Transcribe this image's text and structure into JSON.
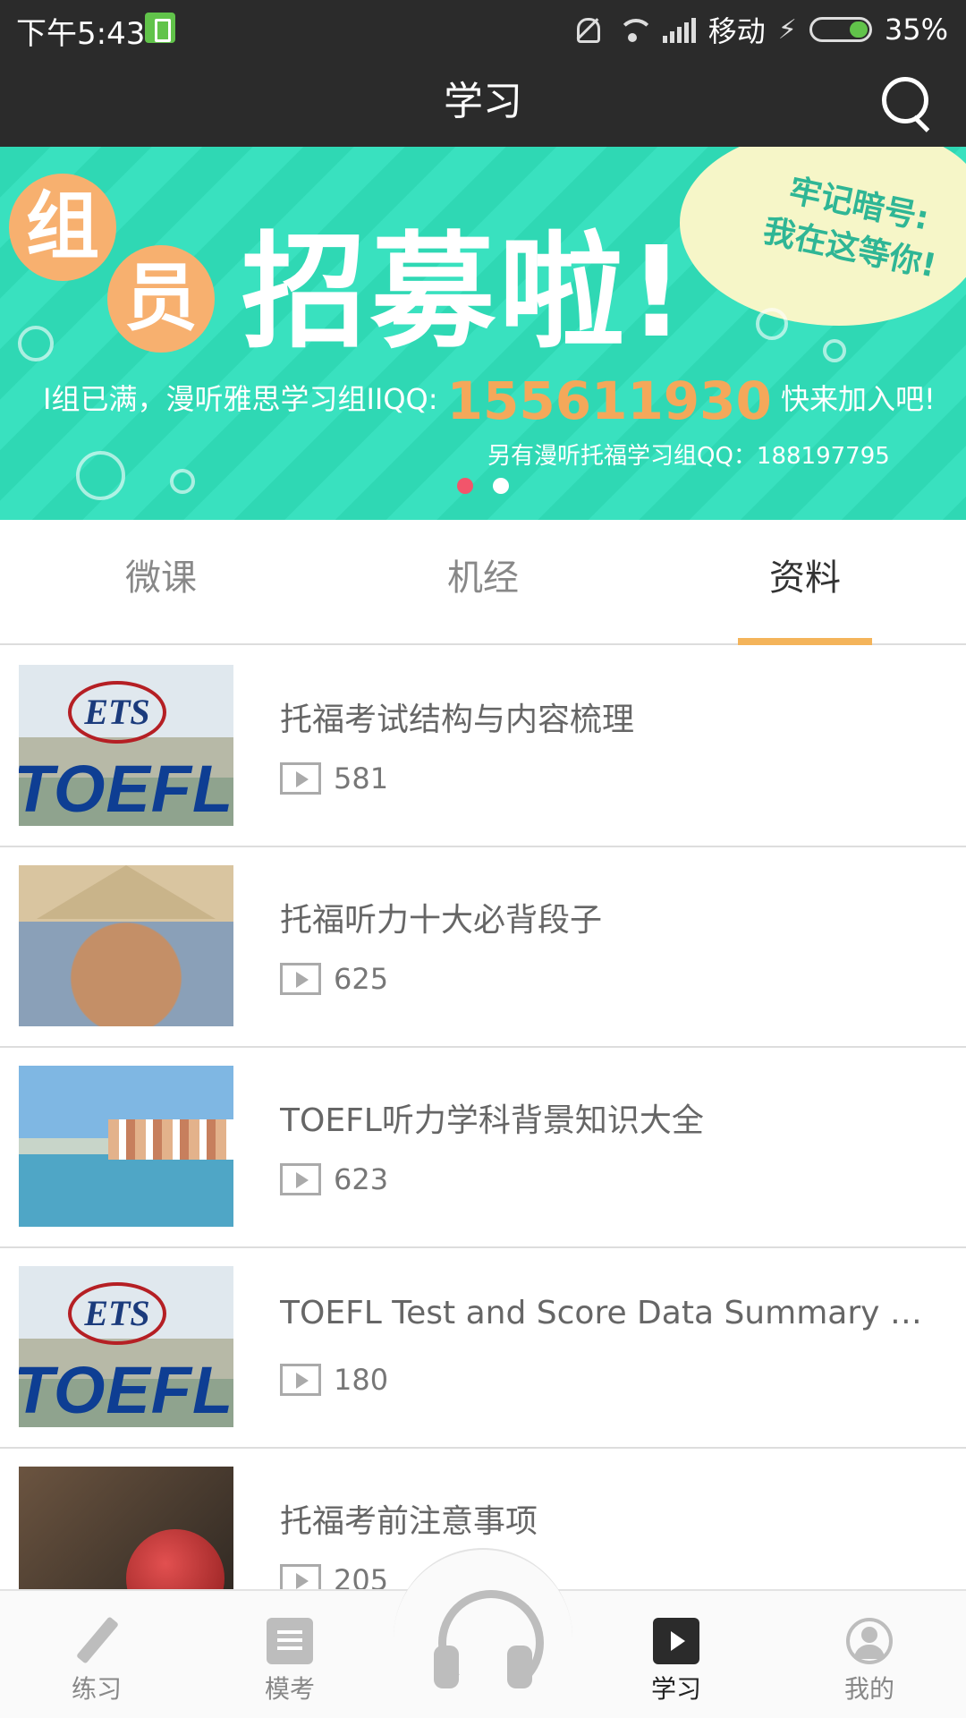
{
  "status_bar": {
    "time": "下午5:43",
    "carrier": "移动",
    "battery": "35%"
  },
  "header": {
    "title": "学习",
    "search_icon": "search-icon"
  },
  "banner": {
    "badge_chars": [
      "组",
      "员"
    ],
    "headline": "招募啦!",
    "slogan_line1": "牢记暗号:",
    "slogan_line2": "我在这等你!",
    "line1_prefix": "I组已满，漫听雅思学习组IIQQ:",
    "line1_qq": "155611930",
    "line1_suffix": "快来加入吧!",
    "line2": "另有漫听托福学习组QQ：188197795",
    "page_count": 2,
    "active_page": 0
  },
  "tabs": [
    {
      "label": "微课",
      "active": false
    },
    {
      "label": "机经",
      "active": false
    },
    {
      "label": "资料",
      "active": true
    }
  ],
  "items": [
    {
      "title": "托福考试结构与内容梳理",
      "plays": "581",
      "thumb": "ets-toefl",
      "thumb_ets": "ETS",
      "thumb_toefl": "TOEFL"
    },
    {
      "title": "托福听力十大必背段子",
      "plays": "625",
      "thumb": "student-book"
    },
    {
      "title": "TOEFL听力学科背景知识大全",
      "plays": "623",
      "thumb": "coastal-town"
    },
    {
      "title": "TOEFL Test and Score Data Summary 20...",
      "plays": "180",
      "thumb": "ets-toefl",
      "thumb_ets": "ETS",
      "thumb_toefl": "TOEFL"
    },
    {
      "title": "托福考前注意事项",
      "plays": "205",
      "thumb": "boxing-glove"
    }
  ],
  "bottom_nav": [
    {
      "label": "练习",
      "icon": "pencil-icon",
      "active": false
    },
    {
      "label": "模考",
      "icon": "document-icon",
      "active": false
    },
    {
      "label": "",
      "icon": "headphones-icon",
      "active": false
    },
    {
      "label": "学习",
      "icon": "play-square-icon",
      "active": true
    },
    {
      "label": "我的",
      "icon": "user-icon",
      "active": false
    }
  ],
  "colors": {
    "bar_bg": "#2b2b2b",
    "banner_teal": "#2fd8b4",
    "tab_underline": "#f4b45a",
    "dot_active": "#f2556b"
  }
}
